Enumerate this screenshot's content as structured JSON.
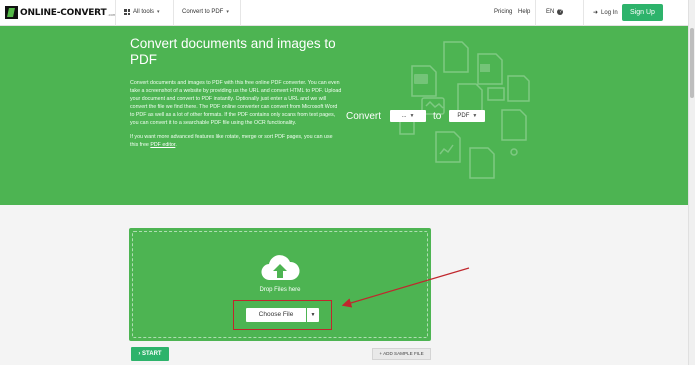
{
  "nav": {
    "logo_text": "ONLINE-CONVERT",
    "logo_suffix": ".com",
    "all_tools": "All tools",
    "convert_to_pdf": "Convert to PDF",
    "pricing": "Pricing",
    "help": "Help",
    "language": "EN",
    "login": "Log In",
    "signup": "Sign Up"
  },
  "hero": {
    "title": "Convert documents and images to PDF",
    "paragraph1": "Convert documents and images to PDF with this free online PDF converter. You can even take a screenshot of a website by providing us the URL and convert HTML to PDF. Upload your document and convert to PDF instantly. Optionally just enter a URL and we will convert the file we find there. The PDF online converter can convert from Microsoft Word to PDF as well as a lot of other formats. If the PDF contains only scans from text pages, you can convert it to a searchable PDF file using the OCR functionality.",
    "paragraph2_before": "If you want more advanced features like rotate, merge or sort PDF pages, you can use this free ",
    "paragraph2_link": "PDF editor",
    "paragraph2_after": ".",
    "convert_label": "Convert",
    "from_value": "...",
    "to_label": "to",
    "to_value": "PDF"
  },
  "upload": {
    "drop_text": "Drop Files here",
    "choose_file": "Choose File",
    "start": "START",
    "add_sample": "ADD SAMPLE FILE"
  },
  "colors": {
    "brand_green": "#4db452",
    "button_green": "#2db36b",
    "annotation_red": "#c0272d"
  },
  "icons": [
    "grid-icon",
    "chevron-down-icon",
    "help-icon",
    "login-icon",
    "cloud-upload-icon",
    "plus-icon",
    "start-chevron-icon"
  ]
}
